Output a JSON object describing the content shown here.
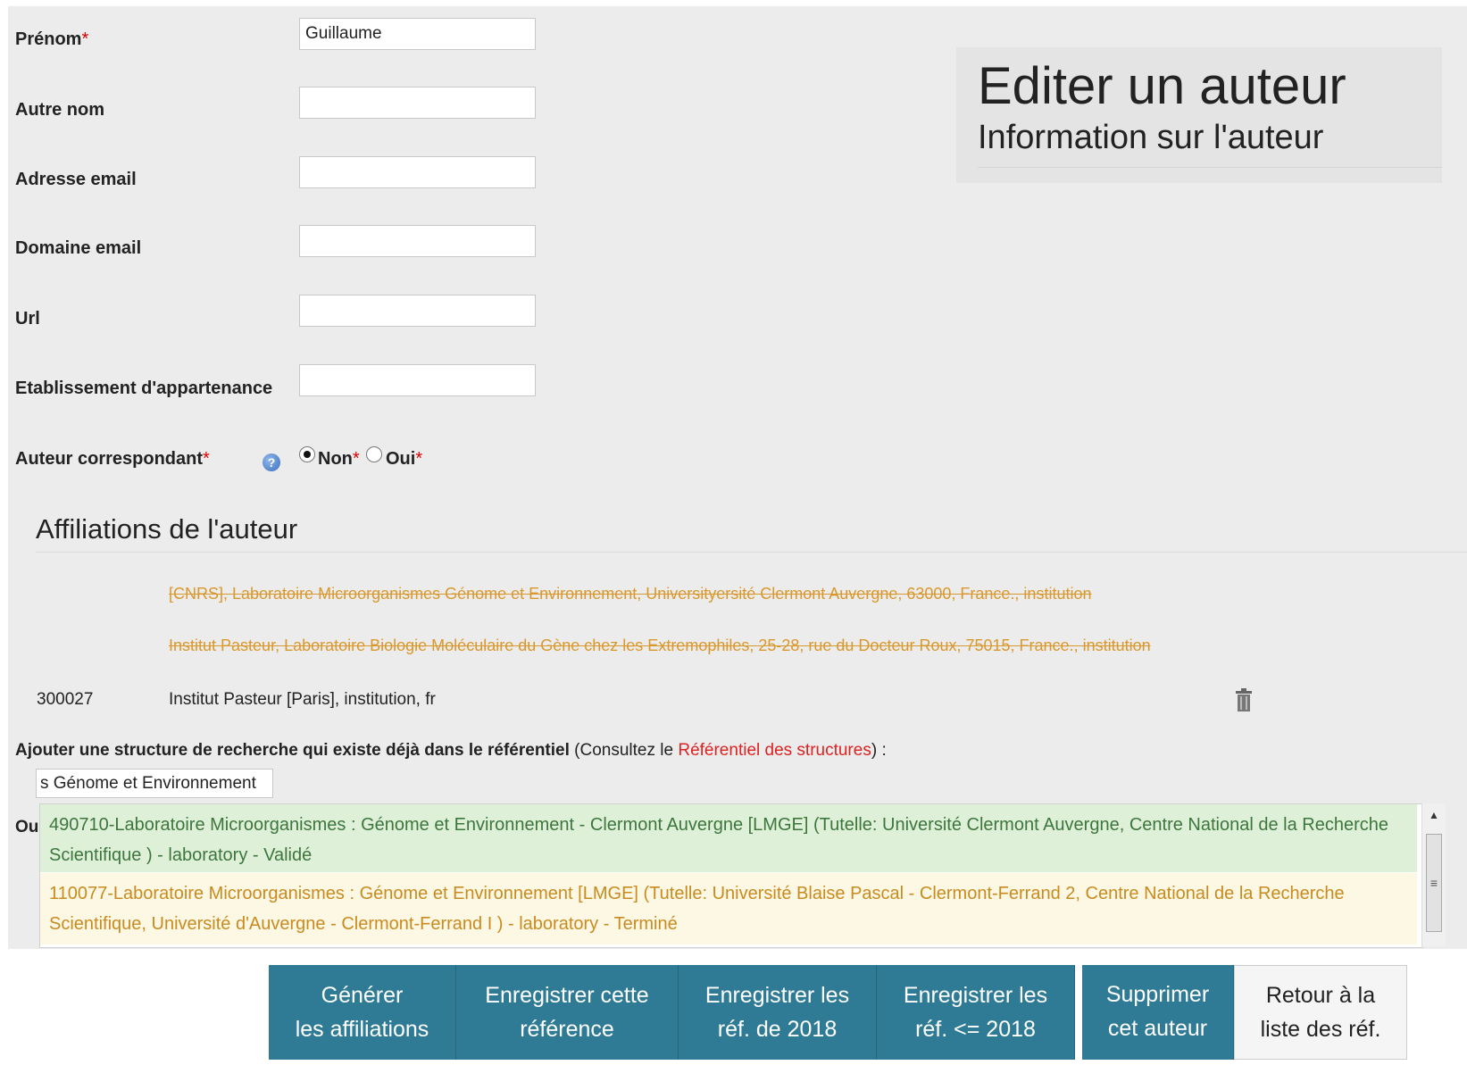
{
  "form": {
    "prenom": {
      "label": "Prénom",
      "required": "*",
      "value": "Guillaume"
    },
    "autre_nom": {
      "label": "Autre nom",
      "value": ""
    },
    "email": {
      "label": "Adresse email",
      "value": ""
    },
    "domaine": {
      "label": "Domaine email",
      "value": ""
    },
    "url": {
      "label": "Url",
      "value": ""
    },
    "etablissement": {
      "label": "Etablissement d'appartenance",
      "value": ""
    },
    "correspondant": {
      "label": "Auteur correspondant",
      "required": "*",
      "help_icon": "question-circle-icon",
      "options": [
        {
          "label": "Non",
          "required": "*",
          "selected": true
        },
        {
          "label": "Oui",
          "required": "*",
          "selected": false
        }
      ]
    }
  },
  "panel": {
    "title": "Editer un auteur",
    "subtitle": "Information sur l'auteur"
  },
  "affiliations": {
    "heading": "Affiliations de l'auteur",
    "removed": [
      "[CNRS], Laboratoire Microorganismes Génome et Environnement, Universityersité Clermont Auvergne, 63000, France., institution",
      "Institut Pasteur, Laboratoire Biologie Moléculaire du Gène chez les Extremophiles, 25-28, rue du Docteur Roux, 75015, France., institution"
    ],
    "current": {
      "id": "300027",
      "text": "Institut Pasteur [Paris], institution, fr",
      "icon": "trash-icon"
    }
  },
  "add_structure": {
    "label_bold": "Ajouter une structure de recherche qui existe déjà dans le référentiel",
    "paren_open": " (Consultez le ",
    "link": "Référentiel des structures",
    "paren_close": ") :",
    "search_value": "s Génome et Environnement",
    "ou_label": "Ou"
  },
  "suggestions": [
    {
      "text": "490710-Laboratoire Microorganismes : Génome et Environnement - Clermont Auvergne [LMGE] (Tutelle: Université Clermont Auvergne, Centre National de la Recherche Scientifique ) - laboratory - Validé",
      "status": "valid"
    },
    {
      "text": "110077-Laboratoire Microorganismes : Génome et Environnement [LMGE] (Tutelle: Université Blaise Pascal - Clermont-Ferrand 2, Centre National de la Recherche Scientifique, Université d'Auvergne - Clermont-Ferrand I ) - laboratory - Terminé",
      "status": "ended"
    }
  ],
  "buttons": {
    "generer": [
      "Générer",
      "les affiliations"
    ],
    "enregistrer_ref": [
      "Enregistrer cette",
      "référence"
    ],
    "enregistrer_2018": [
      "Enregistrer les",
      "réf. de 2018"
    ],
    "enregistrer_le_2018": [
      "Enregistrer les",
      "réf. <= 2018"
    ],
    "supprimer": [
      "Supprimer",
      "cet auteur"
    ],
    "retour": [
      "Retour à la",
      "liste des réf."
    ]
  },
  "colors": {
    "accent": "#2f7b95",
    "valid_bg": "#dff0d8",
    "valid_text": "#3c763d",
    "ended_bg": "#fcf8e3",
    "ended_text": "#c98b1f",
    "required": "#dd0000"
  }
}
